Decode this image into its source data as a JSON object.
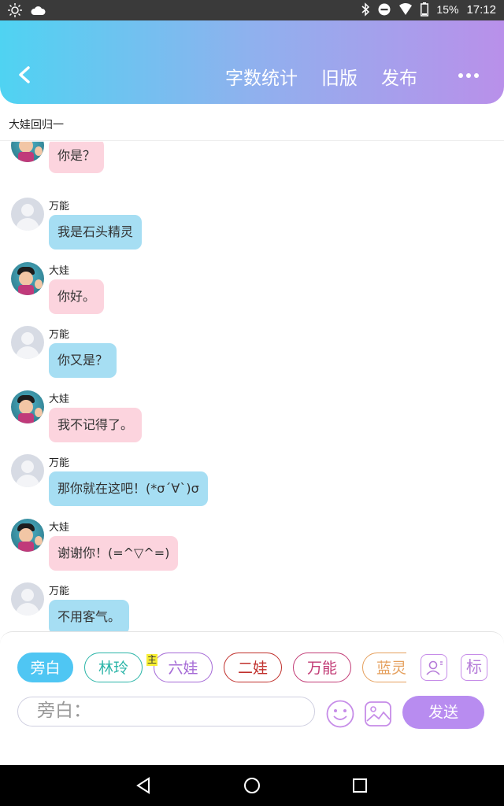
{
  "status_bar": {
    "battery": "15%",
    "time": "17:12"
  },
  "header": {
    "back_icon": "chevron-left",
    "actions": [
      "字数统计",
      "旧版",
      "发布"
    ],
    "more_icon": "more-dots"
  },
  "subtitle": "大娃回归一",
  "messages": [
    {
      "speaker": "大娃",
      "text": "你是？",
      "color": "#fcd4de"
    },
    {
      "speaker": "万能",
      "text": "我是石头精灵",
      "color": "#a6def3"
    },
    {
      "speaker": "大娃",
      "text": "你好。",
      "color": "#fcd4de"
    },
    {
      "speaker": "万能",
      "text": "你又是？",
      "color": "#a6def3"
    },
    {
      "speaker": "大娃",
      "text": "我不记得了。",
      "color": "#fcd4de"
    },
    {
      "speaker": "万能",
      "text": "那你就在这吧！(*σ´∀`)σ",
      "color": "#a6def3"
    },
    {
      "speaker": "大娃",
      "text": "谢谢你！(=^▽^=)",
      "color": "#fcd4de"
    },
    {
      "speaker": "万能",
      "text": "不用客气。",
      "color": "#a6def3"
    }
  ],
  "characters": [
    {
      "label": "旁白",
      "color": "#4fc6f3",
      "active": true
    },
    {
      "label": "林玲",
      "color": "#2bb5a8"
    },
    {
      "label": "六娃",
      "color": "#a56ad6"
    },
    {
      "label": "二娃",
      "color": "#c0302c"
    },
    {
      "label": "万能",
      "color": "#c23c76"
    },
    {
      "label": "蓝灵",
      "color": "#e5a05e"
    }
  ],
  "host_tag": "主",
  "side_icons": {
    "profile_icon": "person-card-icon",
    "tag_label": "标"
  },
  "input": {
    "placeholder": "旁白："
  },
  "send_label": "发送"
}
